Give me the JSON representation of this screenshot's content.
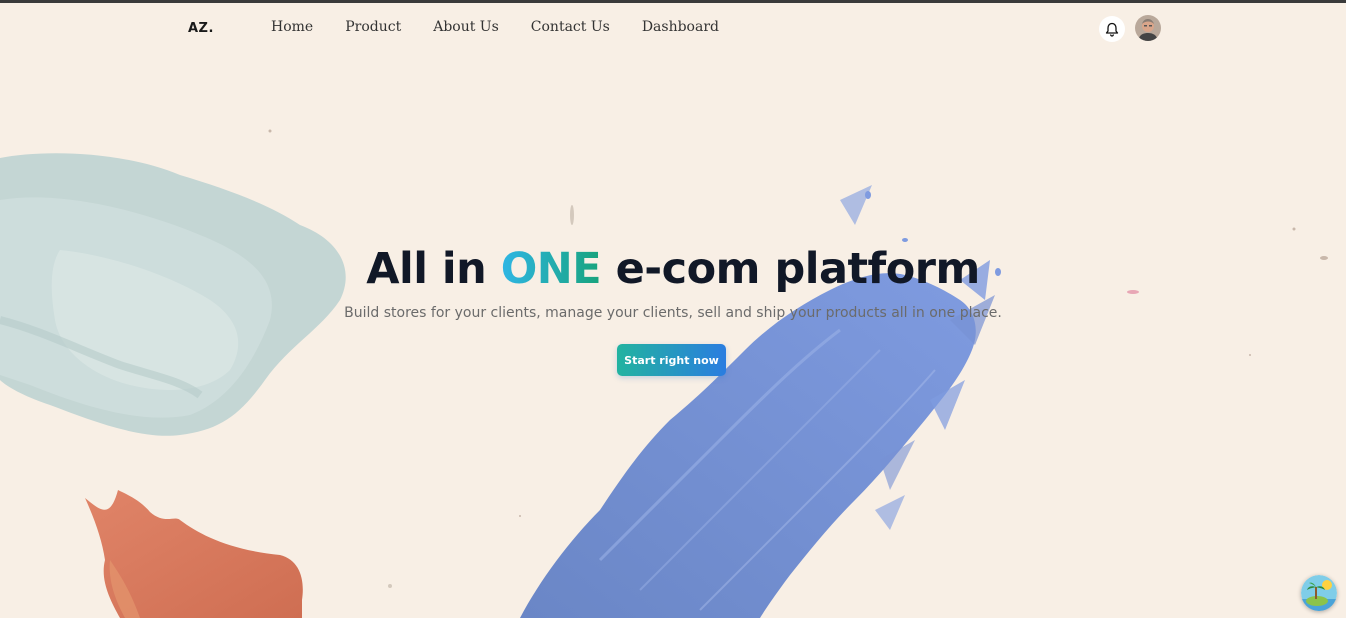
{
  "brand": {
    "logo_text": "AZ."
  },
  "nav": {
    "items": [
      {
        "label": "Home"
      },
      {
        "label": "Product"
      },
      {
        "label": "About Us"
      },
      {
        "label": "Contact Us"
      },
      {
        "label": "Dashboard"
      }
    ]
  },
  "header": {
    "notification_icon": "bell-icon",
    "avatar_icon": "user-avatar"
  },
  "hero": {
    "title_start": "All in ",
    "title_accent": "ONE",
    "title_end": " e-com platform",
    "subtitle": "Build stores for your clients, manage your clients, sell and ship your products all in one place.",
    "cta_label": "Start right now"
  },
  "colors": {
    "background": "#f8efe5",
    "accent_gradient_start": "#2fb6e5",
    "accent_gradient_end": "#18a37c",
    "cta_gradient_start": "#22b3a0",
    "cta_gradient_end": "#2a7de0",
    "title": "#111827"
  }
}
